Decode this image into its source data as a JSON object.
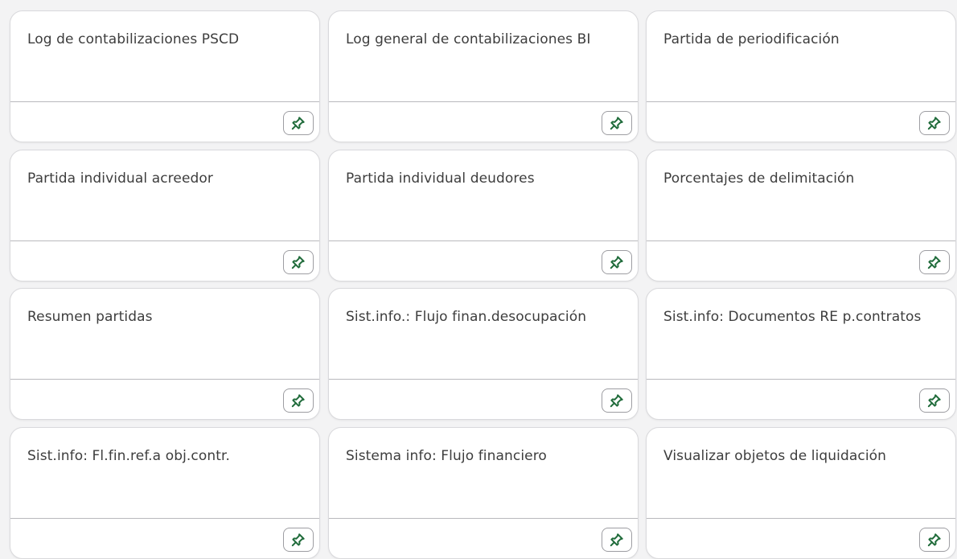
{
  "accent_color": "#1f6b3a",
  "tiles": [
    {
      "title": "Log de contabilizaciones PSCD",
      "pin_icon": "pin-icon"
    },
    {
      "title": "Log general de contabilizaciones BI",
      "pin_icon": "pin-icon"
    },
    {
      "title": "Partida de periodificación",
      "pin_icon": "pin-icon"
    },
    {
      "title": "Partida individual acreedor",
      "pin_icon": "pin-icon"
    },
    {
      "title": "Partida individual deudores",
      "pin_icon": "pin-icon"
    },
    {
      "title": "Porcentajes de delimitación",
      "pin_icon": "pin-icon"
    },
    {
      "title": "Resumen partidas",
      "pin_icon": "pin-icon"
    },
    {
      "title": "Sist.info.: Flujo finan.desocupación",
      "pin_icon": "pin-icon"
    },
    {
      "title": "Sist.info: Documentos RE p.contratos",
      "pin_icon": "pin-icon"
    },
    {
      "title": "Sist.info: Fl.fin.ref.a obj.contr.",
      "pin_icon": "pin-icon"
    },
    {
      "title": "Sistema info: Flujo financiero",
      "pin_icon": "pin-icon"
    },
    {
      "title": "Visualizar objetos de liquidación",
      "pin_icon": "pin-icon"
    }
  ]
}
